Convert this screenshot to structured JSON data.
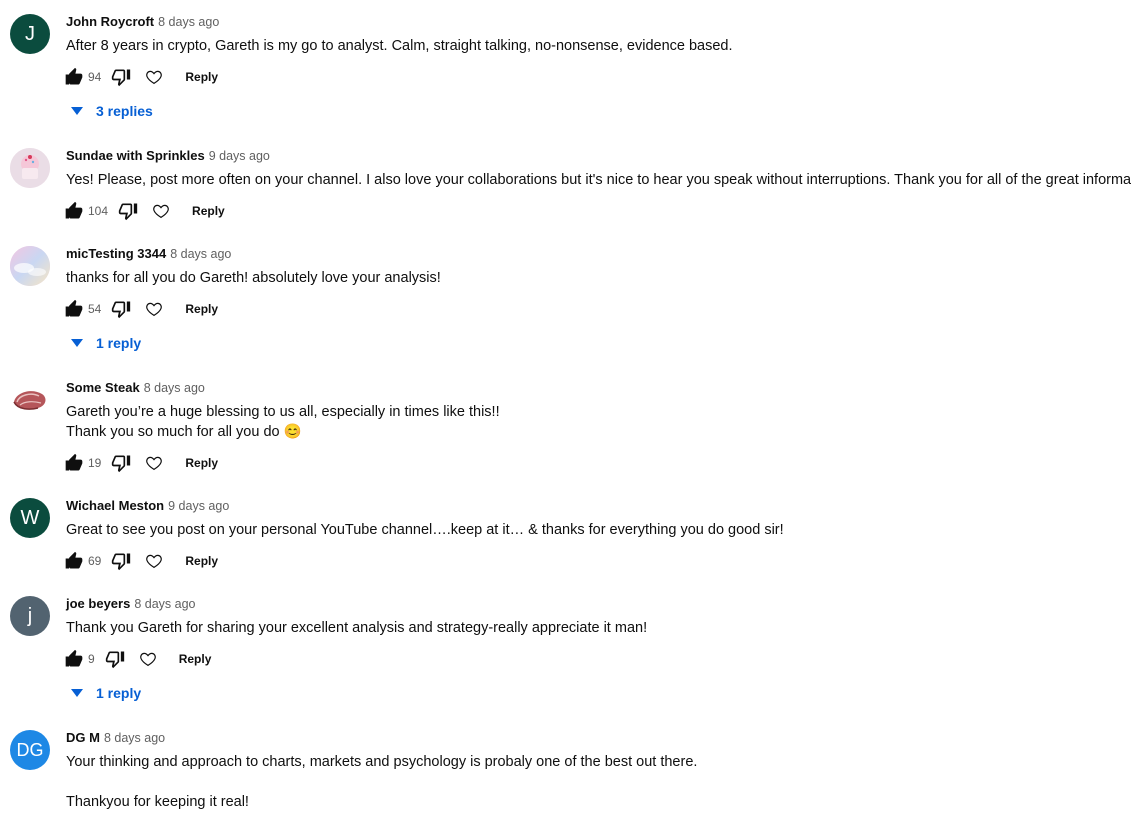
{
  "comments": [
    {
      "author": "John Roycroft",
      "time": "8 days ago",
      "avatar_letter": "J",
      "avatar_color": "#0b4c3e",
      "lines": [
        "After 8 years in crypto, Gareth is my go to analyst. Calm, straight talking, no-nonsense, evidence based."
      ],
      "likes": "94",
      "reply_label": "Reply",
      "replies_label": "3 replies"
    },
    {
      "author": "Sundae with Sprinkles",
      "time": "9 days ago",
      "avatar_letter": "",
      "avatar_color": "#d8b8c6",
      "lines": [
        "Yes! Please, post more often on your channel.  I also love your collaborations but it's nice to hear you speak without interruptions. Thank you for all of the great information."
      ],
      "likes": "104",
      "reply_label": "Reply"
    },
    {
      "author": "micTesting 3344",
      "time": "8 days ago",
      "avatar_letter": "",
      "avatar_color": "#e6c7df",
      "lines": [
        "thanks for all you do Gareth! absolutely love your analysis!"
      ],
      "likes": "54",
      "reply_label": "Reply",
      "replies_label": "1 reply"
    },
    {
      "author": "Some Steak",
      "time": "8 days ago",
      "avatar_letter": "",
      "avatar_color": "#ffffff",
      "lines": [
        "Gareth you’re a huge blessing to us all, especially in times like this!!",
        "Thank you so much for all you do 😊"
      ],
      "likes": "19",
      "reply_label": "Reply"
    },
    {
      "author": "Wichael Meston",
      "time": "9 days ago",
      "avatar_letter": "W",
      "avatar_color": "#0b4c3e",
      "lines": [
        "Great to see you post on your personal YouTube channel….keep at it… & thanks for everything you do good sir!"
      ],
      "likes": "69",
      "reply_label": "Reply"
    },
    {
      "author": "joe beyers",
      "time": "8 days ago",
      "avatar_letter": "j",
      "avatar_color": "#526370",
      "lines": [
        "Thank you Gareth for sharing your excellent analysis and strategy-really appreciate it man!"
      ],
      "likes": "9",
      "reply_label": "Reply",
      "replies_label": "1 reply"
    },
    {
      "author": "DG M",
      "time": "8 days ago",
      "avatar_letter": "DG",
      "avatar_color": "#1e88e5",
      "lines": [
        "Your thinking and approach to charts, markets and psychology is probaly one of the best out there.",
        "",
        "Thankyou for keeping it real!"
      ]
    }
  ]
}
